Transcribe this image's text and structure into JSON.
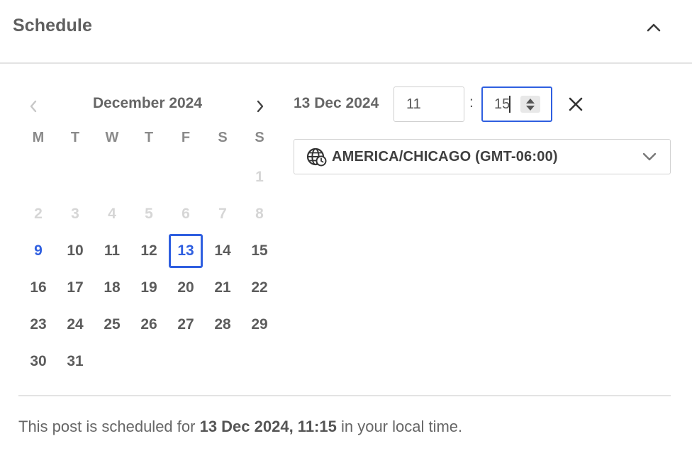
{
  "panel": {
    "title": "Schedule"
  },
  "calendar": {
    "month_label": "December 2024",
    "weekdays": [
      "M",
      "T",
      "W",
      "T",
      "F",
      "S",
      "S"
    ],
    "weeks": [
      [
        null,
        null,
        null,
        null,
        null,
        null,
        {
          "day": "1",
          "state": "other"
        }
      ],
      [
        {
          "day": "2",
          "state": "other"
        },
        {
          "day": "3",
          "state": "other"
        },
        {
          "day": "4",
          "state": "other"
        },
        {
          "day": "5",
          "state": "other"
        },
        {
          "day": "6",
          "state": "other"
        },
        {
          "day": "7",
          "state": "other"
        },
        {
          "day": "8",
          "state": "other"
        }
      ],
      [
        {
          "day": "9",
          "state": "today"
        },
        {
          "day": "10",
          "state": "normal"
        },
        {
          "day": "11",
          "state": "normal"
        },
        {
          "day": "12",
          "state": "normal"
        },
        {
          "day": "13",
          "state": "selected"
        },
        {
          "day": "14",
          "state": "normal"
        },
        {
          "day": "15",
          "state": "normal"
        }
      ],
      [
        {
          "day": "16",
          "state": "normal"
        },
        {
          "day": "17",
          "state": "normal"
        },
        {
          "day": "18",
          "state": "normal"
        },
        {
          "day": "19",
          "state": "normal"
        },
        {
          "day": "20",
          "state": "normal"
        },
        {
          "day": "21",
          "state": "normal"
        },
        {
          "day": "22",
          "state": "normal"
        }
      ],
      [
        {
          "day": "23",
          "state": "normal"
        },
        {
          "day": "24",
          "state": "normal"
        },
        {
          "day": "25",
          "state": "normal"
        },
        {
          "day": "26",
          "state": "normal"
        },
        {
          "day": "27",
          "state": "normal"
        },
        {
          "day": "28",
          "state": "normal"
        },
        {
          "day": "29",
          "state": "normal"
        }
      ],
      [
        {
          "day": "30",
          "state": "normal"
        },
        {
          "day": "31",
          "state": "normal"
        }
      ]
    ]
  },
  "time": {
    "date_label": "13 Dec 2024",
    "hour": "11",
    "separator": ":",
    "minute": "15"
  },
  "timezone": {
    "label": "AMERICA/CHICAGO (GMT-06:00)",
    "icon": "globe-clock-icon"
  },
  "footer": {
    "prefix": "This post is scheduled for ",
    "datetime": "13 Dec 2024, 11:15",
    "suffix": " in your local time."
  },
  "colors": {
    "accent": "#2f5fe0",
    "muted_day": "#d6d6d6",
    "text": "#5c5c5c",
    "border": "#e3e3e3"
  }
}
